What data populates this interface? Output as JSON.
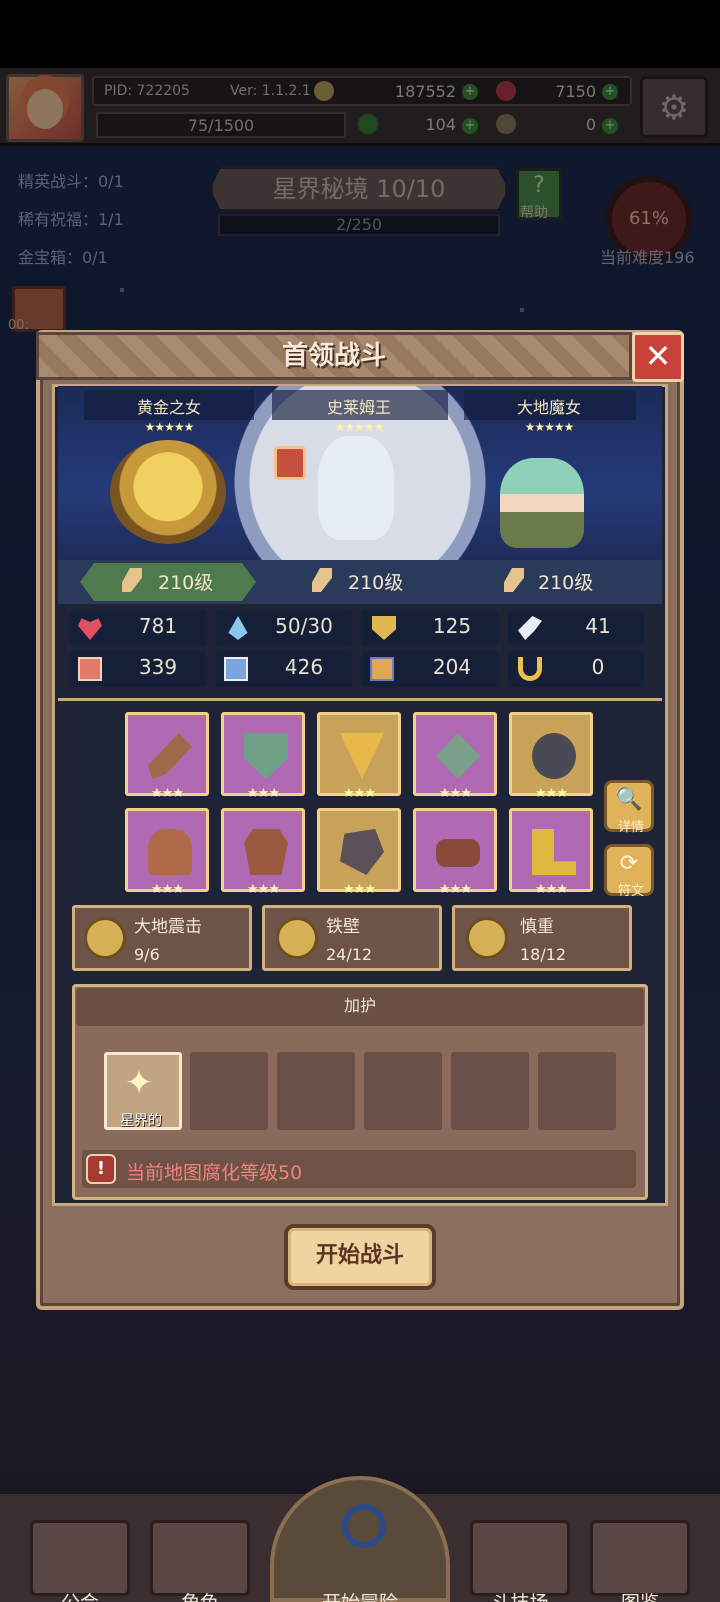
{
  "header": {
    "pid": "PID: 722205",
    "version": "Ver: 1.1.2.1",
    "gold": "187552",
    "gems": "7150",
    "energy": "75/1500",
    "clover": "104",
    "keys": "0"
  },
  "left_info": {
    "elite_battle": "精英战斗：0/1",
    "rare_blessing": "稀有祝福：1/1",
    "gold_chest": "金宝箱：0/1",
    "timer": "00:"
  },
  "realm": {
    "title": "星界秘境 10/10",
    "progress": "2/250",
    "help": "帮助",
    "difficulty_pct": "61%",
    "difficulty_label": "当前难度196"
  },
  "modal": {
    "title": "首领战斗",
    "close": "✕",
    "bosses": [
      {
        "name": "黄金之女",
        "stars": "★★★★★",
        "level": "210级"
      },
      {
        "name": "史莱姆王",
        "stars": "★★★★★",
        "level": "210级"
      },
      {
        "name": "大地魔女",
        "stars": "★★★★★",
        "level": "210级"
      }
    ],
    "stats": [
      {
        "icon": "heart-icon",
        "value": "781"
      },
      {
        "icon": "water-drop-icon",
        "value": "50/30"
      },
      {
        "icon": "shield-icon",
        "value": "125"
      },
      {
        "icon": "wing-icon",
        "value": "41"
      },
      {
        "icon": "fist-icon",
        "value": "339"
      },
      {
        "icon": "book-icon",
        "value": "426"
      },
      {
        "icon": "boot-icon",
        "value": "204"
      },
      {
        "icon": "magnet-icon",
        "value": "0"
      }
    ],
    "equipment_stars": "★★★",
    "detail_label": "详情",
    "rune_label": "符文",
    "skills": [
      {
        "name": "大地震击",
        "count": "9/6"
      },
      {
        "name": "铁壁",
        "count": "24/12"
      },
      {
        "name": "慎重",
        "count": "18/12"
      }
    ],
    "blessing_header": "加护",
    "blessing_slot_label": "星界的",
    "warning": "当前地图腐化等级50",
    "start_button": "开始战斗"
  },
  "nav": {
    "guild": "公会",
    "character": "角色",
    "adventure": "开始冒险",
    "arena": "斗技场",
    "codex": "图鉴"
  },
  "colors": {
    "modal_border": "#c8a27a",
    "purple_rarity": "#b06ab4",
    "gold_rarity": "#c9a25a",
    "warning_text": "#f0827a"
  }
}
